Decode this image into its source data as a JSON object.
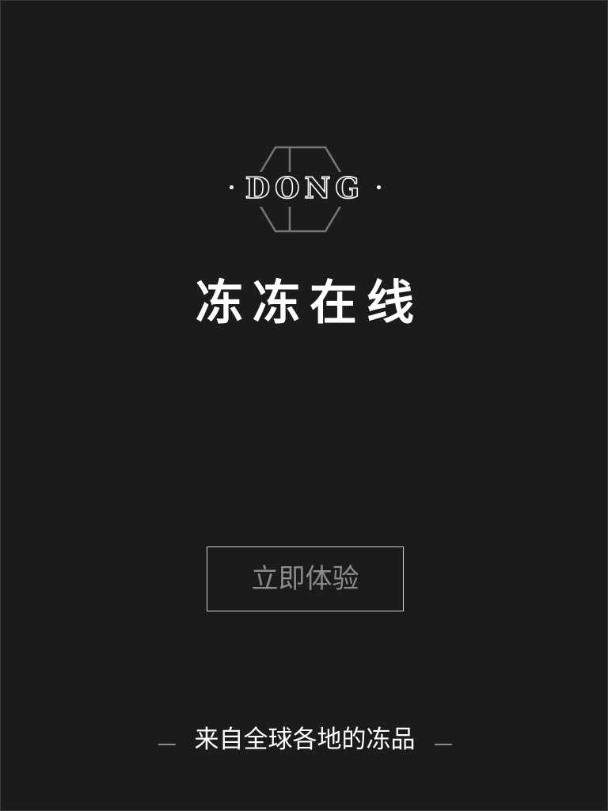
{
  "logo": {
    "wordmark": "DONG"
  },
  "app": {
    "title": "冻冻在线"
  },
  "cta": {
    "label": "立即体验"
  },
  "footer": {
    "tagline": "来自全球各地的冻品"
  },
  "colors": {
    "background": "#1b1b1b",
    "text": "#ffffff",
    "button_text": "#8c8c8c",
    "button_border": "#d0d0d0",
    "logo_hexagon": "#777777"
  },
  "icons": {
    "logo_mark": "hexagon-logo-icon",
    "separators": "dash-icon"
  }
}
